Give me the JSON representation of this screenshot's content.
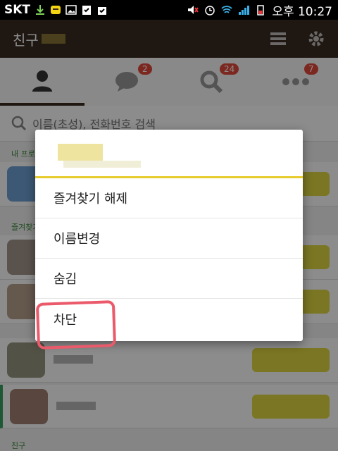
{
  "statusbar": {
    "carrier": "SKT",
    "time": "오후 10:27"
  },
  "header": {
    "title": "친구"
  },
  "tabs": [
    {
      "name": "friends",
      "badge": ""
    },
    {
      "name": "chats",
      "badge": "2"
    },
    {
      "name": "find",
      "badge": "24"
    },
    {
      "name": "more",
      "badge": "7"
    }
  ],
  "search": {
    "placeholder": "이름(초성), 전화번호 검색"
  },
  "sections": {
    "my_profile": "내 프로필",
    "favorites": "즐겨찾기",
    "friends": "친구"
  },
  "dialog": {
    "items": [
      "즐겨찾기 해제",
      "이름변경",
      "숨김",
      "차단"
    ]
  },
  "colors": {
    "header_bg": "#3a2a22",
    "accent_yellow": "#e8cc2e",
    "badge_red": "#e24a3b",
    "annotation": "#ea5a6a"
  }
}
